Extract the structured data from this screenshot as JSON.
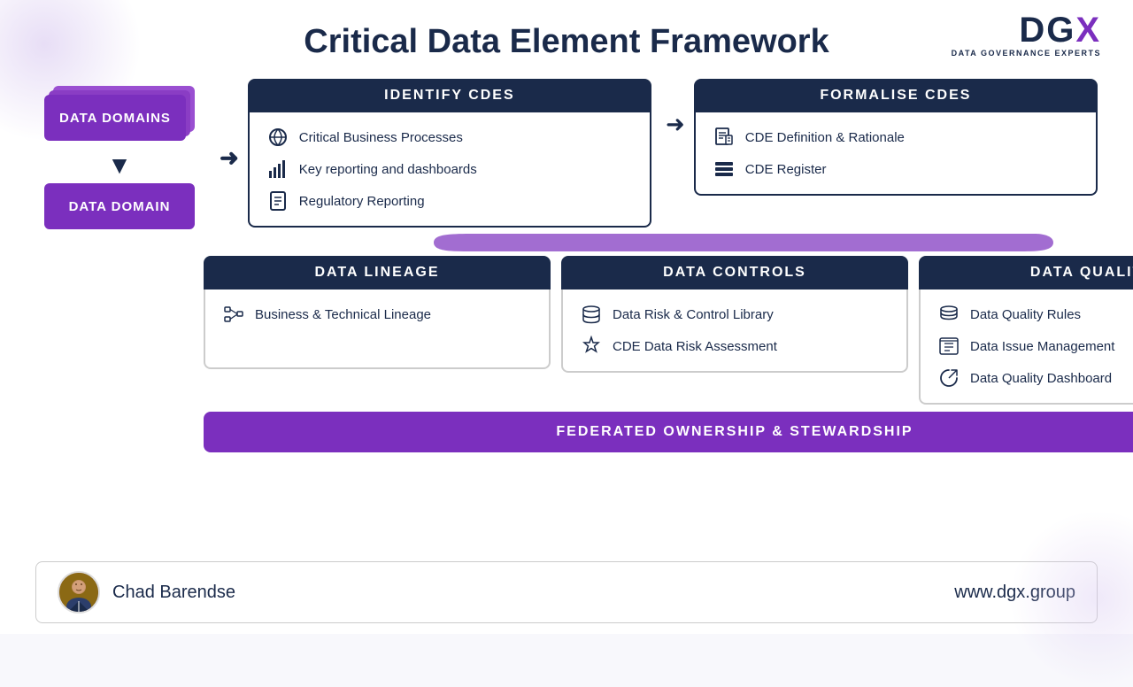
{
  "page": {
    "title": "Critical Data Element Framework",
    "logo": {
      "dgx": "DGX",
      "x_letter": "X",
      "subtitle": "DATA GOVERNANCE EXPERTS",
      "url": "www.dgx.group"
    },
    "footer": {
      "name": "Chad Barendse",
      "url": "www.dgx.group"
    }
  },
  "domains": {
    "label_stack": "DATA DOMAINS",
    "label_single": "DATA DOMAIN"
  },
  "identify": {
    "header": "IDENTIFY CDES",
    "items": [
      {
        "icon": "⚙",
        "text": "Critical Business Processes"
      },
      {
        "icon": "📊",
        "text": "Key reporting and dashboards"
      },
      {
        "icon": "📄",
        "text": "Regulatory Reporting"
      }
    ]
  },
  "formalise": {
    "header": "FORMALISE CDES",
    "items": [
      {
        "icon": "📋",
        "text": "CDE Definition & Rationale"
      },
      {
        "icon": "🗄",
        "text": "CDE Register"
      }
    ]
  },
  "lineage": {
    "header": "DATA LINEAGE",
    "items": [
      {
        "icon": "⊞",
        "text": "Business & Technical Lineage"
      }
    ]
  },
  "controls": {
    "header": "DATA CONTROLS",
    "items": [
      {
        "icon": "🗄",
        "text": "Data Risk & Control Library"
      },
      {
        "icon": "🛡",
        "text": "CDE Data Risk Assessment"
      }
    ]
  },
  "quality": {
    "header": "DATA QUALITY",
    "items": [
      {
        "icon": "🗄",
        "text": "Data Quality Rules"
      },
      {
        "icon": "📋",
        "text": "Data Issue Management"
      },
      {
        "icon": "↻",
        "text": "Data Quality Dashboard"
      }
    ]
  },
  "federated": {
    "label": "FEDERATED OWNERSHIP & STEWARDSHIP"
  }
}
